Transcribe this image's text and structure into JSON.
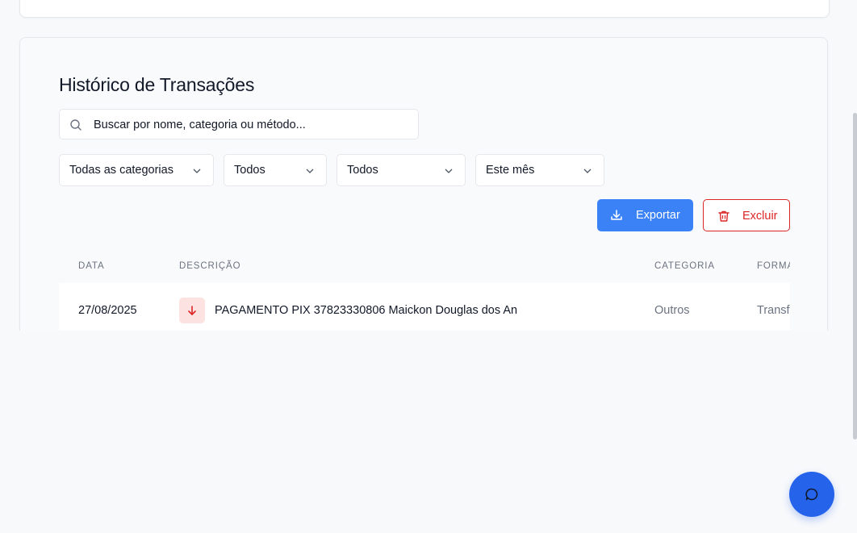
{
  "section": {
    "title": "Histórico de Transações"
  },
  "search": {
    "placeholder": "Buscar por nome, categoria ou método..."
  },
  "filters": {
    "category": "Todas as categorias",
    "type": "Todos",
    "method": "Todos",
    "period": "Este mês"
  },
  "actions": {
    "export_label": "Exportar",
    "delete_label": "Excluir"
  },
  "table": {
    "columns": [
      "DATA",
      "DESCRIÇÃO",
      "CATEGORIA",
      "FORMA"
    ],
    "rows": [
      {
        "date": "27/08/2025",
        "description": "PAGAMENTO PIX 37823330806 Maickon Douglas dos An",
        "category": "Outros",
        "method": "Transf",
        "type_icon": "arrow-down-icon"
      }
    ]
  },
  "colors": {
    "primary": "#3b82f6",
    "danger": "#dc2626",
    "expense_bg": "#fde2e2",
    "fab": "#2563eb"
  },
  "icons": {
    "search": "search-icon",
    "chevron": "chevron-down-icon",
    "export": "download-icon",
    "delete": "trash-icon",
    "chat": "chat-icon"
  }
}
